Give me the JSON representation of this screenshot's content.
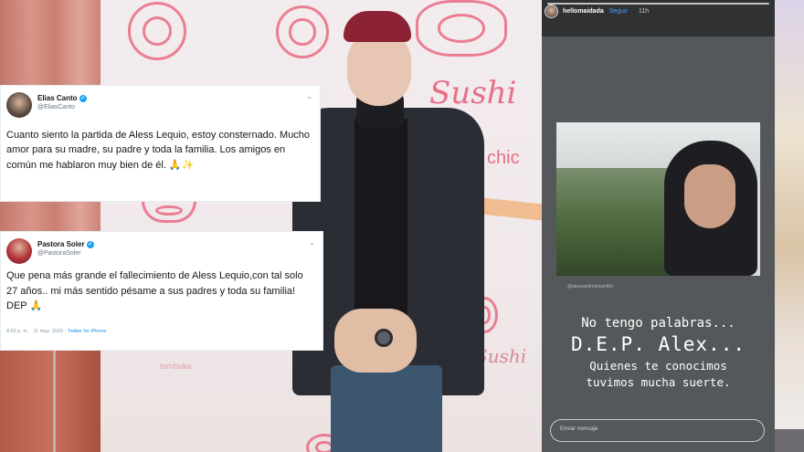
{
  "backdrop": {
    "wall_brand": "Sushi",
    "wall_tagline": "chic",
    "wall_sub_brand": "Sushi",
    "wall_small_text": "tembuka"
  },
  "tweet1": {
    "name": "Elias Canto",
    "handle": "@EliasCanto",
    "text": "Cuanto siento la partida de Aless Lequio, estoy consternado. Mucho amor para su madre, su padre y toda la familia. Los amigos en común me hablaron muy bien de él. 🙏✨"
  },
  "tweet2": {
    "name": "Pastora Soler",
    "handle": "@PastoraSoler",
    "text": "Que pena más grande el fallecimiento de Aless Lequio,con tal solo 27 años.. mi más sentido pésame a sus padres y toda su familia! DEP 🙏",
    "meta_time": "8:53 p. m. · 11 may. 2020 ·",
    "meta_source": "Twitter for iPhone"
  },
  "story": {
    "username": "hellomaidada",
    "tag": "Seguir",
    "time": "11h",
    "photo_caption": "@alessandrolequiofilm",
    "line1": "No tengo palabras...",
    "line2": "D.E.P. Alex...",
    "line3": "Quienes te conocimos",
    "line4": "tuvimos mucha suerte.",
    "reply_placeholder": "Enviar mensaje"
  },
  "colors": {
    "twitter_blue": "#1da1f2",
    "wall_pink": "#e86f86",
    "story_bg": "#55585a"
  },
  "icons": {
    "verified": "verified-badge-icon",
    "chevron": "chevron-down-icon"
  }
}
